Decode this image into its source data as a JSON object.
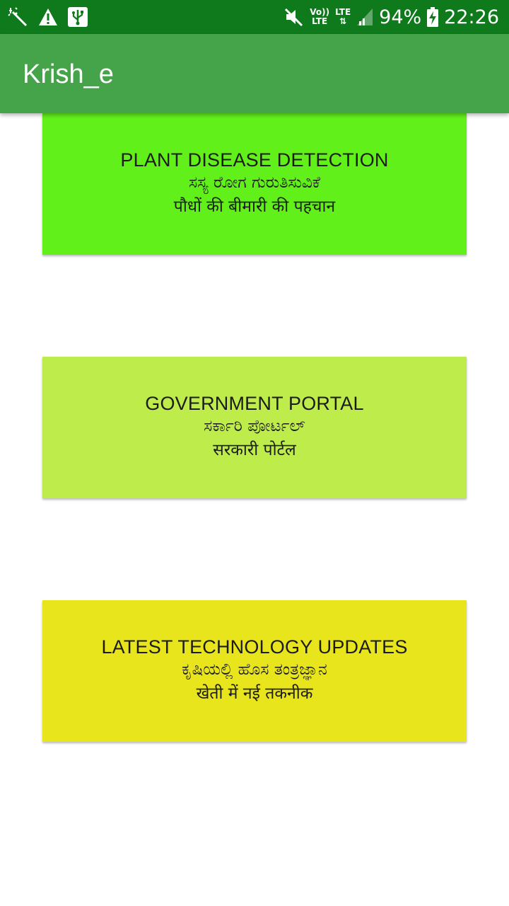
{
  "status_bar": {
    "left_icons": [
      "magic-wand-icon",
      "warning-icon",
      "usb-icon"
    ],
    "right_icons": [
      "mute-icon",
      "volte-icon",
      "lte-data-icon",
      "signal-icon",
      "battery-charging-icon"
    ],
    "volte_top": "Vo))",
    "volte_bottom": "LTE",
    "lte_label": "LTE",
    "battery": "94%",
    "time": "22:26"
  },
  "app_bar": {
    "title": "Krish_e",
    "color": "#45a44a"
  },
  "cards": [
    {
      "english": "PLANT DISEASE DETECTION",
      "kannada": "ಸಸ್ಯ ರೋಗ ಗುರುತಿಸುವಿಕೆ",
      "hindi": "पौधों की बीमारी की पहचान",
      "color": "#62f01b"
    },
    {
      "english": "GOVERNMENT PORTAL",
      "kannada": "ಸರ್ಕಾರಿ ಪೋರ್ಟಲ್",
      "hindi": "सरकारी पोर्टल",
      "color": "#bdec4b"
    },
    {
      "english": "LATEST TECHNOLOGY UPDATES",
      "kannada": "ಕೃಷಿಯಲ್ಲಿ ಹೊಸ ತಂತ್ರಜ್ಞಾನ",
      "hindi": "खेती में नई तकनीक",
      "color": "#e8e51c"
    }
  ]
}
